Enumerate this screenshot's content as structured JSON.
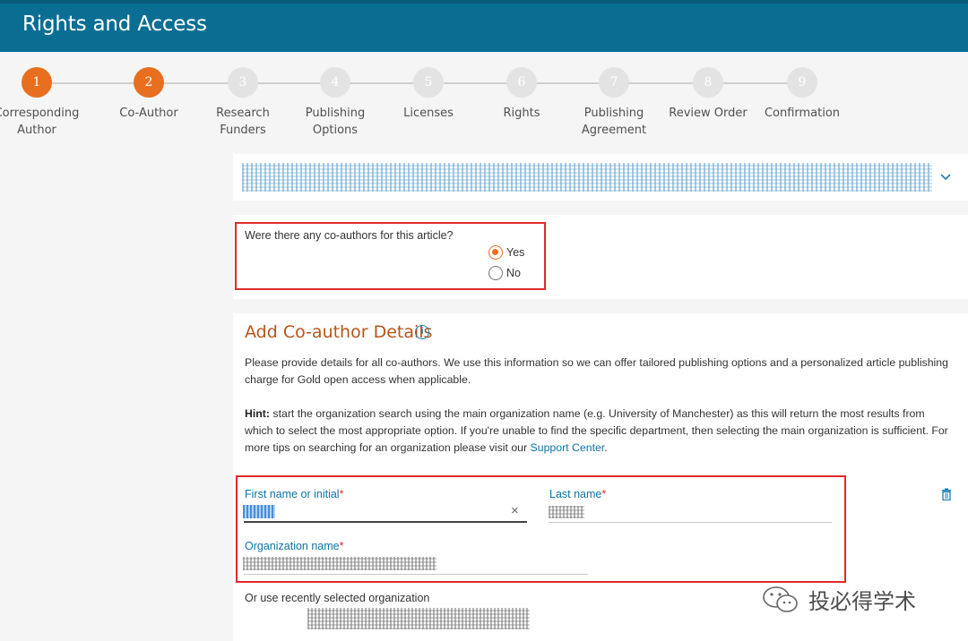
{
  "header": {
    "title": "Rights and Access"
  },
  "stepper": {
    "steps": [
      {
        "number": "1",
        "label_line1": "Corresponding",
        "label_line2": "Author",
        "active": true
      },
      {
        "number": "2",
        "label_line1": "Co-Author",
        "label_line2": "",
        "active": true
      },
      {
        "number": "3",
        "label_line1": "Research",
        "label_line2": "Funders",
        "active": false
      },
      {
        "number": "4",
        "label_line1": "Publishing",
        "label_line2": "Options",
        "active": false
      },
      {
        "number": "5",
        "label_line1": "Licenses",
        "label_line2": "",
        "active": false
      },
      {
        "number": "6",
        "label_line1": "Rights",
        "label_line2": "",
        "active": false
      },
      {
        "number": "7",
        "label_line1": "Publishing",
        "label_line2": "Agreement",
        "active": false
      },
      {
        "number": "8",
        "label_line1": "Review Order",
        "label_line2": "",
        "active": false
      },
      {
        "number": "9",
        "label_line1": "Confirmation",
        "label_line2": "",
        "active": false
      }
    ]
  },
  "coauthor_question": {
    "question": "Were there any co-authors for this article?",
    "options": [
      {
        "label": "Yes",
        "selected": true
      },
      {
        "label": "No",
        "selected": false
      }
    ]
  },
  "details": {
    "title": "Add Co-author Details",
    "intro": "Please provide details for all co-authors. We use this information so we can offer tailored publishing options and a personalized article publishing charge for Gold open access when applicable.",
    "hint_label": "Hint:",
    "hint_text": " start the organization search using the main organization name (e.g. University of Manchester) as this will return the most results from which to select the most appropriate option. If you're unable to find the specific department, then selecting the main organization is sufficient. For more tips on searching for an organization please visit our ",
    "hint_link": "Support Center",
    "hint_end": ".",
    "first_name_label": "First name or initial",
    "last_name_label": "Last name",
    "org_label": "Organization name",
    "required_mark": "*",
    "recent_org_label": "Or use recently selected organization"
  },
  "watermark": {
    "text": "投必得学术"
  },
  "colors": {
    "header": "#0a6e93",
    "accent": "#e86f1f",
    "link": "#0d74a8",
    "highlight_box": "#e02a2a"
  }
}
